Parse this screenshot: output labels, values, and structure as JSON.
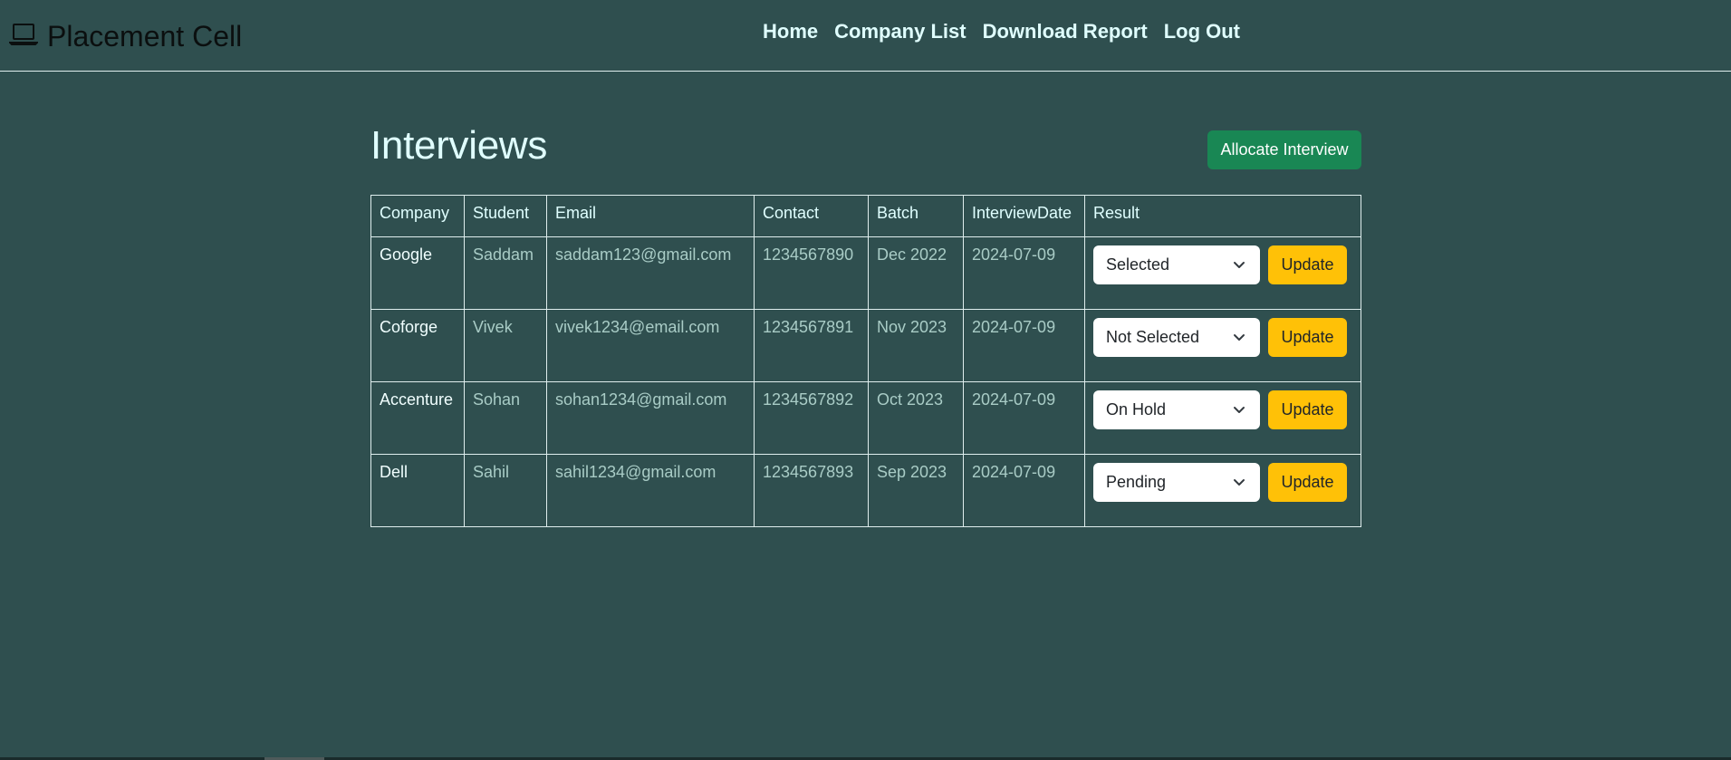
{
  "navbar": {
    "brand_icon": "laptop-icon",
    "brand": "Placement Cell",
    "links": [
      {
        "label": "Home"
      },
      {
        "label": "Company List"
      },
      {
        "label": "Download Report"
      },
      {
        "label": "Log Out"
      }
    ]
  },
  "main": {
    "title": "Interviews",
    "allocate_button": "Allocate Interview",
    "table": {
      "headers": [
        "Company",
        "Student",
        "Email",
        "Contact",
        "Batch",
        "InterviewDate",
        "Result"
      ],
      "rows": [
        {
          "company": "Google",
          "student": "Saddam",
          "email": "saddam123@gmail.com",
          "contact": "1234567890",
          "batch": "Dec 2022",
          "date": "2024-07-09",
          "result": "Selected",
          "update": "Update"
        },
        {
          "company": "Coforge",
          "student": "Vivek",
          "email": "vivek1234@email.com",
          "contact": "1234567891",
          "batch": "Nov 2023",
          "date": "2024-07-09",
          "result": "Not Selected",
          "update": "Update"
        },
        {
          "company": "Accenture",
          "student": "Sohan",
          "email": "sohan1234@gmail.com",
          "contact": "1234567892",
          "batch": "Oct 2023",
          "date": "2024-07-09",
          "result": "On Hold",
          "update": "Update"
        },
        {
          "company": "Dell",
          "student": "Sahil",
          "email": "sahil1234@gmail.com",
          "contact": "1234567893",
          "batch": "Sep 2023",
          "date": "2024-07-09",
          "result": "Pending",
          "update": "Update"
        }
      ]
    }
  },
  "colors": {
    "background": "#2f4f4f",
    "accent_green": "#198754",
    "accent_yellow": "#ffc107",
    "nav_text": "#e0ffff"
  }
}
